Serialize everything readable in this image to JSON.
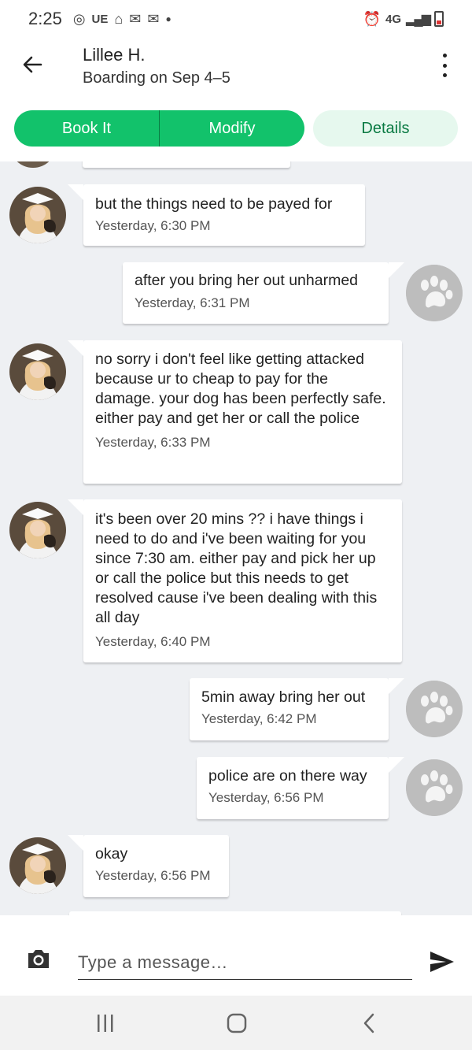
{
  "status_bar": {
    "time": "2:25",
    "carrier": "UE",
    "network": "4G"
  },
  "header": {
    "title": "Lillee H.",
    "subtitle": "Boarding on Sep 4–5"
  },
  "actions": {
    "book_label": "Book It",
    "modify_label": "Modify",
    "details_label": "Details"
  },
  "messages": [
    {
      "side": "in",
      "text": "but the things need to be payed for",
      "time": "Yesterday, 6:30 PM"
    },
    {
      "side": "out",
      "text": "after you bring her out unharmed",
      "time": "Yesterday, 6:31 PM"
    },
    {
      "side": "in",
      "text": "no sorry i don't feel like getting attacked because ur to cheap to pay for the damage. your dog has been perfectly safe. either pay and get her or call the police",
      "time": "Yesterday, 6:33 PM"
    },
    {
      "side": "in",
      "text": "it's been over 20 mins ?? i have things i need to do and i've been waiting for you since 7:30 am. either pay and pick her up or call the police but this needs to get resolved cause i've been dealing with this all day",
      "time": "Yesterday, 6:40 PM"
    },
    {
      "side": "out",
      "text": "5min away bring her out",
      "time": "Yesterday, 6:42 PM"
    },
    {
      "side": "out",
      "text": "police are on there way",
      "time": "Yesterday, 6:56 PM"
    },
    {
      "side": "in",
      "text": "okay",
      "time": "Yesterday, 6:56 PM"
    }
  ],
  "composer": {
    "placeholder": "Type a message…"
  },
  "colors": {
    "accent": "#12c26b",
    "accent_dark": "#0a7a43",
    "details_bg": "#e6f8ee",
    "chat_bg": "#eef0f3"
  }
}
